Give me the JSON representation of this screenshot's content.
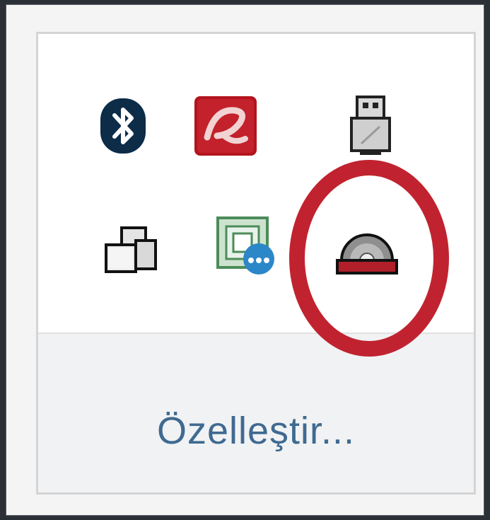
{
  "tray_overflow": {
    "icons": [
      {
        "name": "bluetooth-icon"
      },
      {
        "name": "avira-icon"
      },
      {
        "name": "usb-drive-icon"
      },
      {
        "name": "virtual-desktops-icon"
      },
      {
        "name": "network-chat-icon"
      },
      {
        "name": "optical-drive-icon"
      }
    ],
    "customize_label": "Özelleştir..."
  },
  "colors": {
    "highlight": "#c0232f",
    "link": "#3f6a91",
    "bluetooth": "#0c2c48",
    "avira": "#b3141d"
  }
}
